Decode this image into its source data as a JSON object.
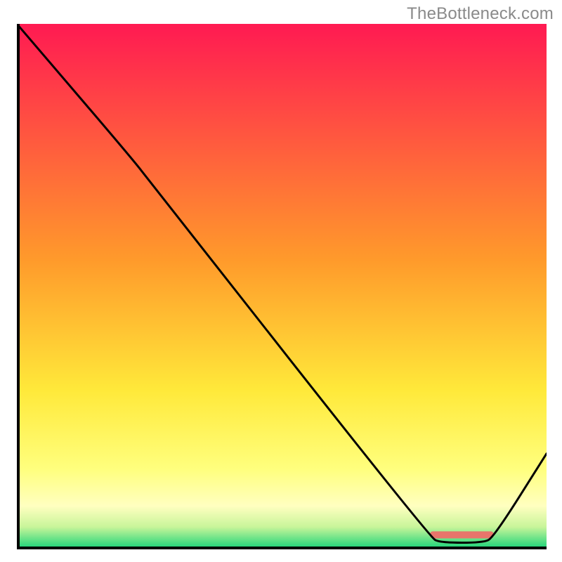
{
  "watermark": "TheBottleneck.com",
  "chart_data": {
    "type": "line",
    "title": "",
    "xlabel": "",
    "ylabel": "",
    "xlim": [
      0,
      100
    ],
    "ylim": [
      0,
      100
    ],
    "background_gradient_stops": [
      {
        "offset": 0.0,
        "color": "#ff1a52"
      },
      {
        "offset": 0.45,
        "color": "#ff9a2b"
      },
      {
        "offset": 0.7,
        "color": "#ffe93a"
      },
      {
        "offset": 0.85,
        "color": "#ffff7e"
      },
      {
        "offset": 0.92,
        "color": "#ffffc0"
      },
      {
        "offset": 0.96,
        "color": "#c8f59a"
      },
      {
        "offset": 1.0,
        "color": "#1ed47a"
      }
    ],
    "curve_points": [
      {
        "x": 0,
        "y": 100
      },
      {
        "x": 22,
        "y": 74
      },
      {
        "x": 25,
        "y": 70
      },
      {
        "x": 78,
        "y": 2
      },
      {
        "x": 80,
        "y": 1
      },
      {
        "x": 88,
        "y": 1
      },
      {
        "x": 90,
        "y": 2
      },
      {
        "x": 100,
        "y": 18
      }
    ],
    "marker_band": {
      "x_start": 78,
      "x_end": 90,
      "y": 2.5,
      "color": "#e8756b"
    }
  }
}
